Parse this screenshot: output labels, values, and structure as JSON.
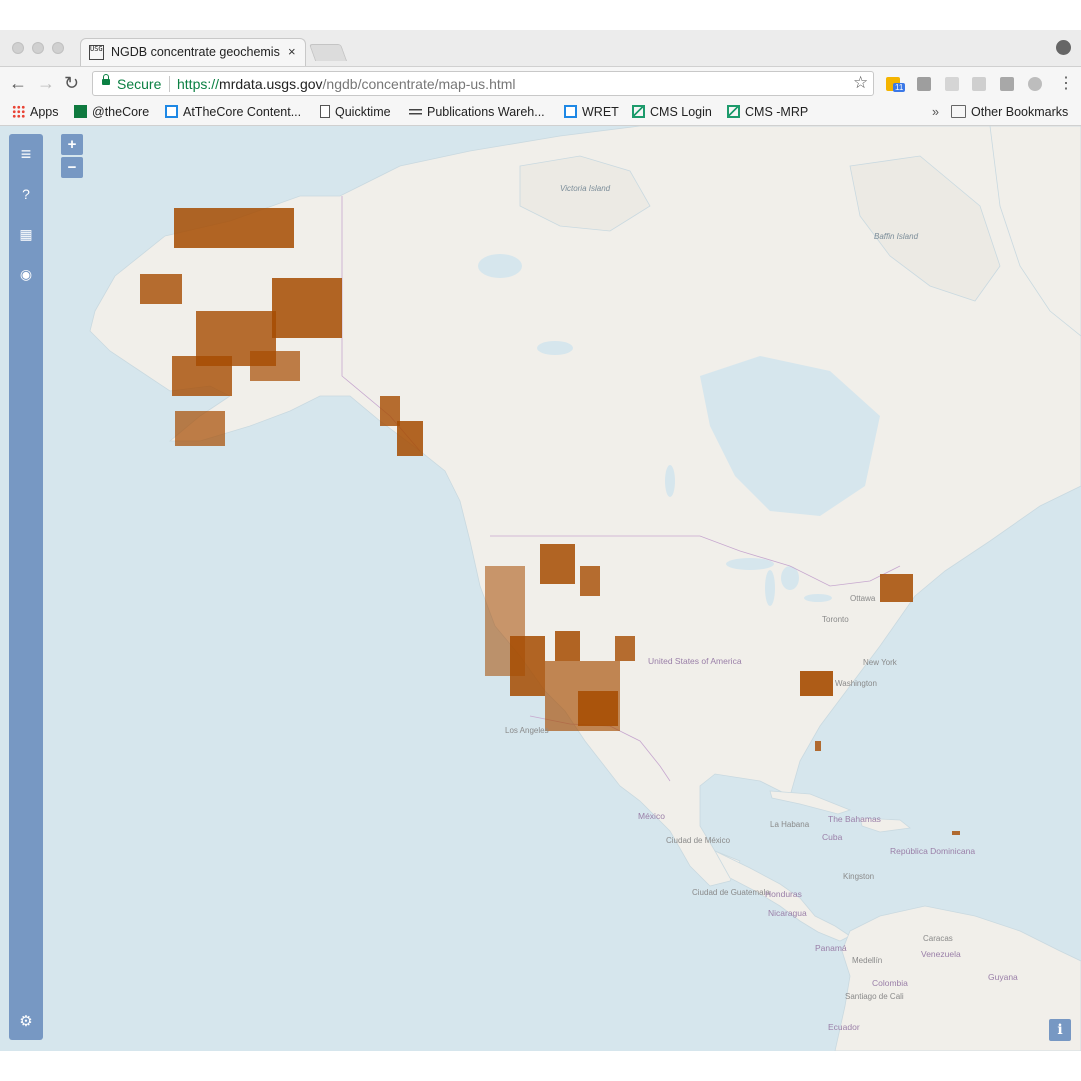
{
  "browser": {
    "tab_title": "NGDB concentrate geochemis",
    "tab_close": "×",
    "tab_favicon": "USGS",
    "secure_label": "Secure",
    "url_scheme": "https://",
    "url_host": "mrdata.usgs.gov",
    "url_path": "/ngdb/concentrate/map-us.html",
    "badge_count": "11"
  },
  "bookmarks": {
    "items": [
      {
        "label": "Apps",
        "icon": "apps-grid-icon"
      },
      {
        "label": "@theCore",
        "icon": "thecore-icon"
      },
      {
        "label": "AtTheCore Content...",
        "icon": "blue-frame-icon"
      },
      {
        "label": "Quicktime",
        "icon": "page-icon"
      },
      {
        "label": "Publications Wareh...",
        "icon": "usgs-wave-icon"
      },
      {
        "label": "WRET",
        "icon": "blue-frame-icon"
      },
      {
        "label": "CMS Login",
        "icon": "cms-icon"
      },
      {
        "label": "CMS -MRP",
        "icon": "cms-icon"
      }
    ],
    "overflow": "»",
    "other": "Other Bookmarks"
  },
  "map": {
    "zoom_in": "+",
    "zoom_out": "−",
    "info": "i",
    "sample_color": "#a64b00",
    "water_color": "#d6e6ed",
    "land_color": "#f1efea",
    "labels": {
      "victoria_island": "Victoria Island",
      "baffin_island": "Baffin Island",
      "united_states": "United States of America",
      "ottawa": "Ottawa",
      "toronto": "Toronto",
      "new_york": "New York",
      "washington": "Washington",
      "los_angeles": "Los Angeles",
      "mexico": "México",
      "ciudad_de_mexico": "Ciudad de México",
      "la_habana": "La Habana",
      "cuba": "Cuba",
      "the_bahamas": "The Bahamas",
      "republica_dominicana": "República Dominicana",
      "kingston": "Kingston",
      "ciudad_de_guatemala": "Ciudad de Guatemala",
      "honduras": "Honduras",
      "nicaragua": "Nicaragua",
      "panama": "Panamá",
      "caracas": "Caracas",
      "venezuela": "Venezuela",
      "medellin": "Medellín",
      "colombia": "Colombia",
      "guyana": "Guyana",
      "santiago_de_cali": "Santiago de Cali",
      "ecuador": "Ecuador"
    }
  }
}
